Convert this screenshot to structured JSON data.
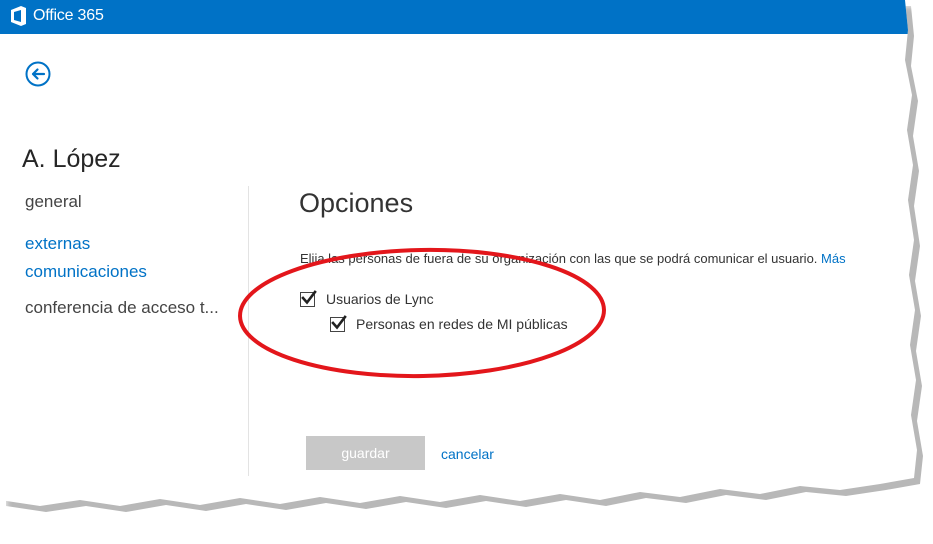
{
  "header": {
    "product_name": "Office 365",
    "logo_icon": "office-logo-icon",
    "bar_color": "#0072c6"
  },
  "back": {
    "icon": "back-arrow-icon"
  },
  "user": {
    "name": "A. López"
  },
  "nav": {
    "items": [
      {
        "label": "general",
        "active": false
      },
      {
        "label": "externas",
        "active": true
      },
      {
        "label": "comunicaciones",
        "active": true
      },
      {
        "label": "conferencia de acceso t...",
        "active": false
      }
    ]
  },
  "options": {
    "title": "Opciones",
    "description": "Elija las personas de fuera de su organización con las que se podrá comunicar el usuario.",
    "more_link": "Más",
    "checkboxes": [
      {
        "label": "Usuarios de Lync",
        "checked": true
      },
      {
        "label": "Personas en redes de MI públicas",
        "checked": true
      }
    ]
  },
  "actions": {
    "save_label": "guardar",
    "cancel_label": "cancelar"
  },
  "annotation": {
    "color": "#e3161b",
    "shape": "ellipse"
  }
}
